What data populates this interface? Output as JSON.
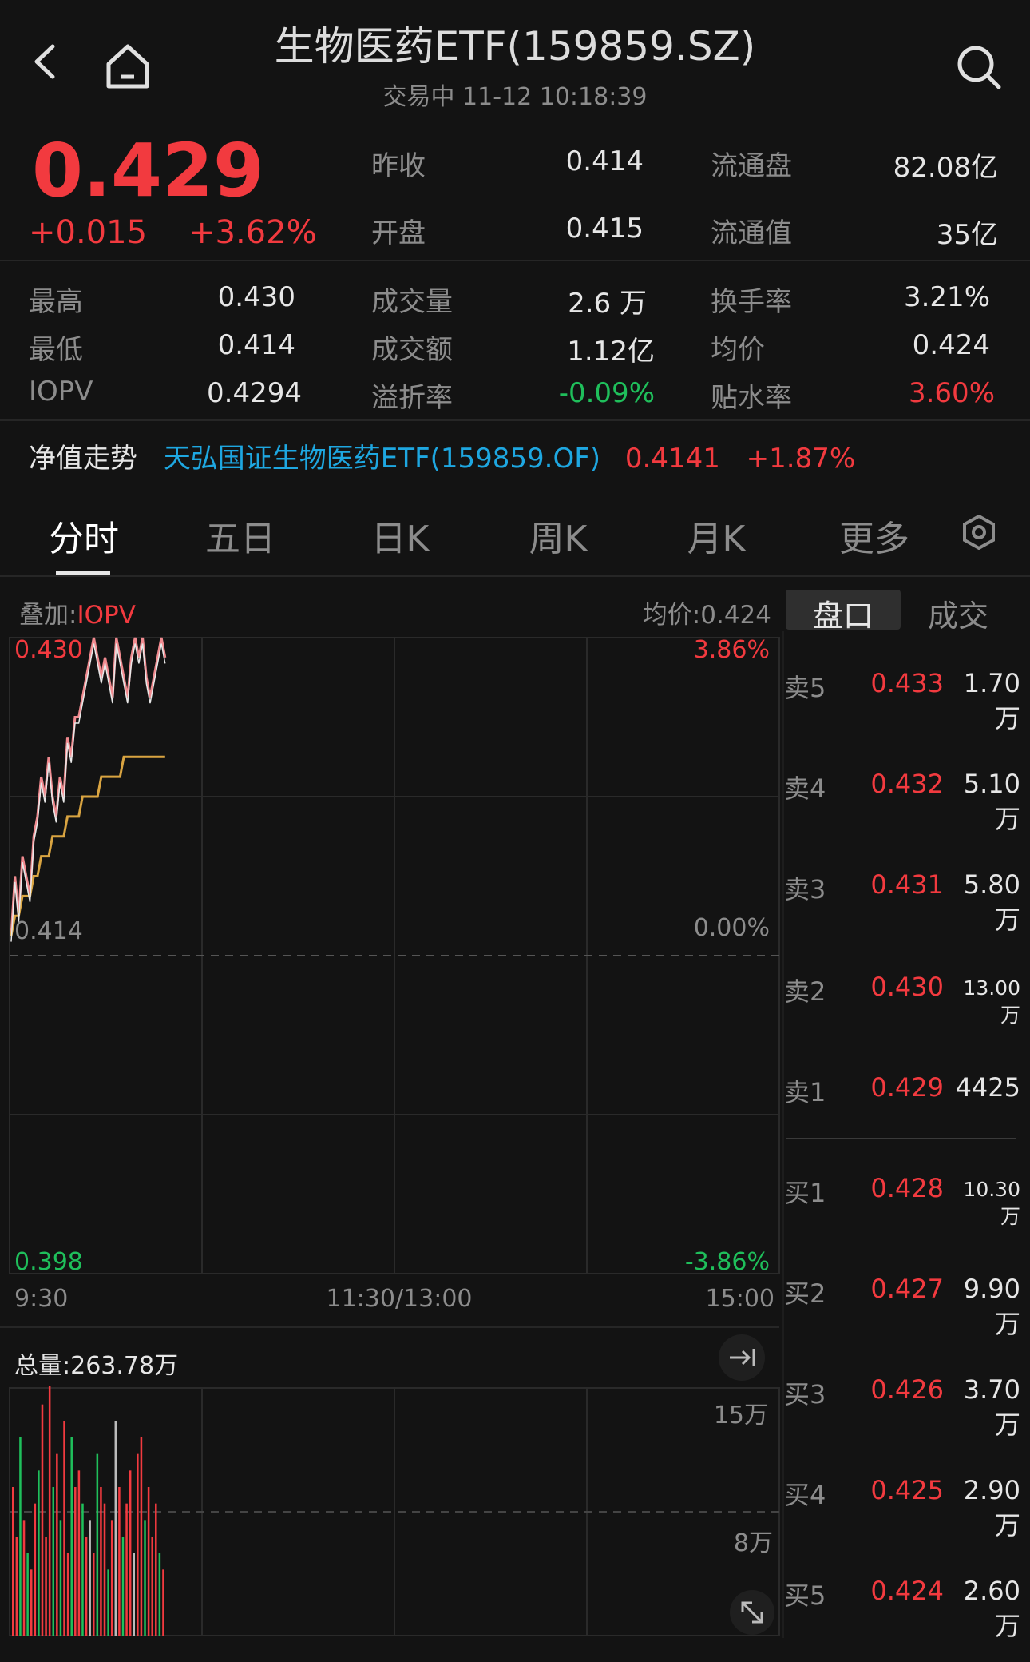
{
  "header": {
    "title": "生物医药ETF(159859.SZ)",
    "subtitle": "交易中  11-12 10:18:39"
  },
  "quote": {
    "price": "0.429",
    "change": "+0.015",
    "change_pct": "+3.62%",
    "stats": [
      {
        "label": "昨收",
        "value": "0.414"
      },
      {
        "label": "流通盘",
        "value": "82.08亿"
      },
      {
        "label": "开盘",
        "value": "0.415"
      },
      {
        "label": "流通值",
        "value": "35亿"
      },
      {
        "label": "最高",
        "value": "0.430"
      },
      {
        "label": "成交量",
        "value": "2.6 万"
      },
      {
        "label": "换手率",
        "value": "3.21%"
      },
      {
        "label": "最低",
        "value": "0.414"
      },
      {
        "label": "成交额",
        "value": "1.12亿"
      },
      {
        "label": "均价",
        "value": "0.424"
      },
      {
        "label": "IOPV",
        "value": "0.4294"
      },
      {
        "label": "溢折率",
        "value": "-0.09%"
      },
      {
        "label": "贴水率",
        "value": "3.60%"
      }
    ]
  },
  "nav": {
    "label": "净值走势",
    "fund_name": "天弘国证生物医药ETF(159859.OF)",
    "value": "0.4141",
    "pct": "+1.87%"
  },
  "tabs": [
    "分时",
    "五日",
    "日K",
    "周K",
    "月K",
    "更多"
  ],
  "chart": {
    "overlay_label": "叠加:",
    "overlay_value": "IOPV",
    "avg_label": "均价:0.424",
    "y_top": "0.430",
    "y_mid": "0.414",
    "y_bottom": "0.398",
    "pct_top": "3.86%",
    "pct_mid": "0.00%",
    "pct_bottom": "-3.86%",
    "time_start": "9:30",
    "time_mid": "11:30/13:00",
    "time_end": "15:00",
    "total_volume": "总量:263.78万",
    "vol_top": "15万",
    "vol_mid": "8万"
  },
  "chart_data": {
    "type": "line",
    "title": "",
    "ylim": [
      0.398,
      0.43
    ],
    "series": [
      {
        "values": [
          0.415,
          0.418,
          0.416,
          0.419,
          0.418,
          0.417,
          0.42,
          0.421,
          0.423,
          0.422,
          0.424,
          0.422,
          0.421,
          0.423,
          0.422,
          0.425,
          0.424,
          0.426,
          0.426,
          0.427,
          0.428,
          0.429,
          0.43,
          0.429,
          0.428,
          0.429,
          0.428,
          0.427,
          0.43,
          0.429,
          0.428,
          0.427,
          0.429,
          0.43,
          0.429,
          0.43,
          0.428,
          0.427,
          0.428,
          0.429,
          0.43,
          0.429
        ]
      },
      {
        "values": [
          0.415,
          0.416,
          0.416,
          0.417,
          0.417,
          0.417,
          0.418,
          0.418,
          0.419,
          0.419,
          0.419,
          0.42,
          0.42,
          0.42,
          0.42,
          0.421,
          0.421,
          0.421,
          0.421,
          0.422,
          0.422,
          0.422,
          0.422,
          0.422,
          0.423,
          0.423,
          0.423,
          0.423,
          0.423,
          0.423,
          0.424,
          0.424,
          0.424,
          0.424,
          0.424,
          0.424,
          0.424,
          0.424,
          0.424,
          0.424,
          0.424,
          0.424
        ]
      }
    ],
    "volumes": [
      9,
      6,
      12,
      7,
      5,
      4,
      8,
      10,
      14,
      6,
      16,
      9,
      11,
      7,
      13,
      5,
      12,
      9,
      10,
      8,
      6,
      7,
      5,
      11,
      9,
      8,
      4,
      7,
      13,
      9,
      6,
      8,
      10,
      5,
      11,
      12,
      7,
      9,
      6,
      8,
      5,
      4
    ],
    "volume_colors": [
      "r",
      "r",
      "g",
      "r",
      "g",
      "r",
      "r",
      "g",
      "r",
      "r",
      "r",
      "g",
      "r",
      "g",
      "r",
      "r",
      "g",
      "r",
      "r",
      "g",
      "r",
      "w",
      "r",
      "g",
      "r",
      "r",
      "g",
      "r",
      "w",
      "r",
      "g",
      "r",
      "r",
      "w",
      "r",
      "r",
      "g",
      "r",
      "r",
      "r",
      "g",
      "r"
    ]
  },
  "orderbook": {
    "tabs": [
      "盘口",
      "成交"
    ],
    "asks": [
      {
        "label": "卖5",
        "price": "0.433",
        "vol": "1.70万"
      },
      {
        "label": "卖4",
        "price": "0.432",
        "vol": "5.10万"
      },
      {
        "label": "卖3",
        "price": "0.431",
        "vol": "5.80万"
      },
      {
        "label": "卖2",
        "price": "0.430",
        "vol": "13.00万"
      },
      {
        "label": "卖1",
        "price": "0.429",
        "vol": "4425"
      }
    ],
    "bids": [
      {
        "label": "买1",
        "price": "0.428",
        "vol": "10.30万"
      },
      {
        "label": "买2",
        "price": "0.427",
        "vol": "9.90万"
      },
      {
        "label": "买3",
        "price": "0.426",
        "vol": "3.70万"
      },
      {
        "label": "买4",
        "price": "0.425",
        "vol": "2.90万"
      },
      {
        "label": "买5",
        "price": "0.424",
        "vol": "2.60万"
      }
    ]
  }
}
